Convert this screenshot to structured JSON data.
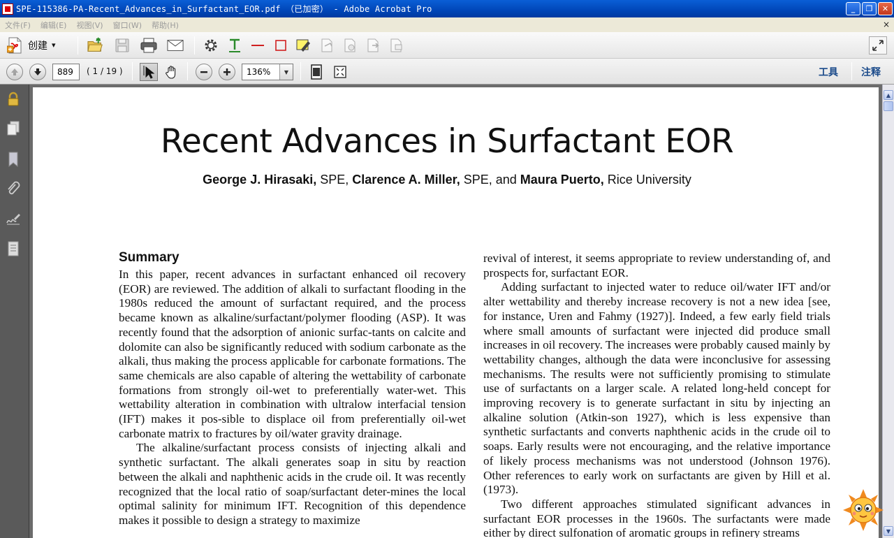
{
  "window": {
    "title": "SPE-115386-PA-Recent_Advances_in_Surfactant_EOR.pdf （已加密） - Adobe Acrobat Pro",
    "minimize": "_",
    "maximize": "❐",
    "close": "✕"
  },
  "menu": {
    "items": [
      "文件(F)",
      "编辑(E)",
      "视图(V)",
      "窗口(W)",
      "帮助(H)"
    ],
    "close_glyph": "×"
  },
  "toolbar": {
    "create_label": "创建",
    "create_dropdown": "▾"
  },
  "nav": {
    "page_number": "889",
    "page_count": "( 1 / 19 )",
    "zoom": "136%",
    "zoom_dropdown": "▼",
    "tools_label": "工具",
    "comments_label": "注释"
  },
  "document": {
    "title": "Recent Advances in Surfactant EOR",
    "authors": [
      {
        "name": "George J. Hirasaki,",
        "affil": " SPE, "
      },
      {
        "name": "Clarence A. Miller,",
        "affil": " SPE, and "
      },
      {
        "name": "Maura Puerto,",
        "affil": " Rice University"
      }
    ],
    "summary_heading": "Summary",
    "left_paragraphs": [
      "In this paper, recent advances in surfactant enhanced oil recovery (EOR) are reviewed. The addition of alkali to surfactant flooding in the 1980s reduced the amount of surfactant required, and the process became known as alkaline/surfactant/polymer flooding (ASP). It was recently found that the adsorption of anionic surfac-tants on calcite and dolomite can also be significantly reduced with sodium carbonate as the alkali, thus making the process applicable for carbonate formations. The same chemicals are also capable of altering the wettability of carbonate formations from strongly oil-wet to preferentially water-wet. This wettability alteration in combination with ultralow interfacial tension (IFT) makes it pos-sible to displace oil from preferentially oil-wet carbonate matrix to fractures by oil/water gravity drainage.",
      "The alkaline/surfactant process consists of injecting alkali and synthetic surfactant. The alkali generates soap in situ by reaction between the alkali and naphthenic acids in the crude oil. It was recently recognized that the local ratio of soap/surfactant deter-mines the local optimal salinity for minimum IFT. Recognition of this dependence makes it possible to design a strategy to maximize"
    ],
    "right_paragraphs": [
      "revival of interest, it seems appropriate to review understanding of, and prospects for, surfactant EOR.",
      "Adding surfactant to injected water to reduce oil/water IFT and/or alter wettability and thereby increase recovery is not a new idea [see, for instance, Uren and Fahmy (1927)]. Indeed, a few early field trials where small amounts of surfactant were injected did produce small increases in oil recovery. The increases were probably caused mainly by wettability changes, although the data were inconclusive for assessing mechanisms. The results were not sufficiently promising to stimulate use of surfactants on a larger scale. A related long-held concept for improving recovery is to generate surfactant in situ by injecting an alkaline solution (Atkin-son 1927), which is less expensive than synthetic surfactants and converts naphthenic acids in the crude oil to soaps. Early results were not encouraging, and the relative importance of likely process mechanisms was not understood (Johnson 1976). Other references to early work on surfactants are given by Hill et al. (1973).",
      "Two different approaches stimulated significant advances in surfactant EOR processes in the 1960s. The surfactants were made either by direct sulfonation of aromatic groups in refinery streams"
    ]
  },
  "scrollbar": {
    "up": "▲",
    "down": "▼"
  }
}
